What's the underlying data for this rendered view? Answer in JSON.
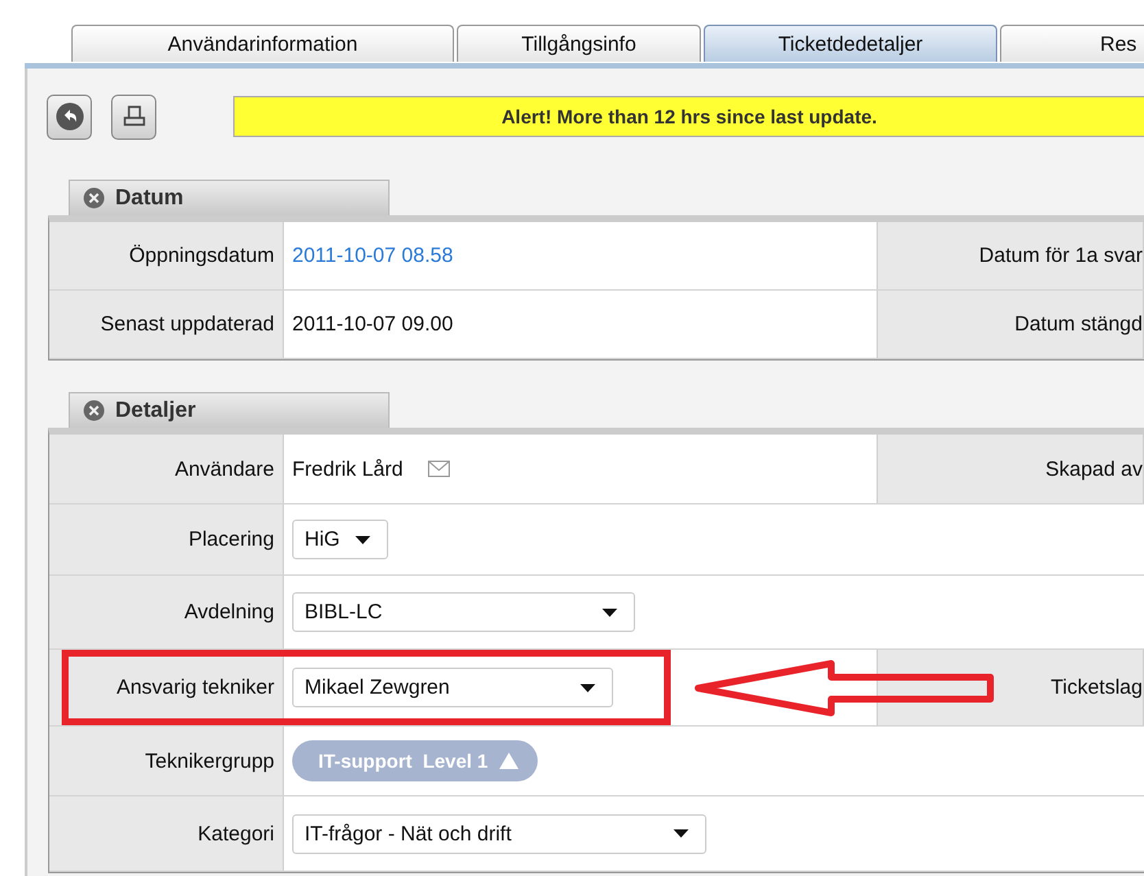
{
  "tabs": [
    {
      "label": "Användarinformation",
      "selected": false
    },
    {
      "label": "Tillgångsinfo",
      "selected": false
    },
    {
      "label": "Ticketdedetaljer",
      "selected": true
    },
    {
      "label": "Res",
      "selected": false
    }
  ],
  "toolbar": {
    "alert": "Alert! More than 12 hrs since last update."
  },
  "sections": [
    {
      "title": "Datum",
      "rows": [
        {
          "label": "Öppningsdatum",
          "kind": "link",
          "value": "2011-10-07 08.58",
          "side_label": "Datum för 1a svar",
          "highlighted": false
        },
        {
          "label": "Senast uppdaterad",
          "kind": "text",
          "value": "2011-10-07 09.00",
          "side_label": "Datum stängd",
          "highlighted": false
        }
      ]
    },
    {
      "title": "Detaljer",
      "rows": [
        {
          "label": "Användare",
          "kind": "contact",
          "value": "Fredrik Lård",
          "side_label": "Skapad av",
          "highlighted": false
        },
        {
          "label": "Placering",
          "kind": "select",
          "value": "HiG",
          "highlighted": false
        },
        {
          "label": "Avdelning",
          "kind": "select",
          "value": "BIBL-LC",
          "highlighted": false
        },
        {
          "label": "Ansvarig tekniker",
          "kind": "select",
          "value": "Mikael Zewgren",
          "side_label": "Ticketslag",
          "highlighted": true
        },
        {
          "label": "Teknikergrupp",
          "kind": "pill",
          "value": "IT-support  Level 1",
          "highlighted": false
        },
        {
          "label": "Kategori",
          "kind": "select",
          "value": "IT-frågor - Nät och drift",
          "highlighted": false
        }
      ]
    }
  ]
}
